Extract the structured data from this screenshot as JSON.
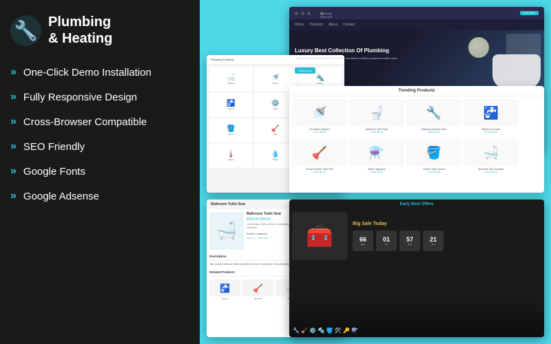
{
  "brand": {
    "name_line1": "Plumbing",
    "name_line2": "& Heating"
  },
  "features": [
    {
      "id": "one-click-demo",
      "label": "One-Click Demo Installation"
    },
    {
      "id": "fully-responsive",
      "label": "Fully Responsive Design"
    },
    {
      "id": "cross-browser",
      "label": "Cross-Browser Compatible"
    },
    {
      "id": "seo-friendly",
      "label": "SEO Friendly"
    },
    {
      "id": "google-fonts",
      "label": "Google Fonts"
    },
    {
      "id": "google-adsense",
      "label": "Google Adsense"
    }
  ],
  "preview": {
    "hero_title": "Luxury Best Collection Of Plumbing",
    "hero_desc": "Vestibulum ante ipsum primis in faucibus orci luctus et ultrices posuere cubilia curae",
    "hero_btn": "Shop Now",
    "trending_title": "Trending Products",
    "trending_products": [
      {
        "name": "Hot Water Systems",
        "price": "From $0.00",
        "icon": "🚿"
      },
      {
        "name": "Bathroom Toilet Seat",
        "price": "From $0.00",
        "icon": "🚽"
      },
      {
        "name": "Washing Machine Valve",
        "price": "From $0.00",
        "icon": "🔧"
      },
      {
        "name": "Bathroom Faucet",
        "price": "From $0.00",
        "icon": "🚰"
      }
    ],
    "detail_title": "Bathroom Toilet Seat",
    "detail_price": "$209.00 $99.00",
    "offers_title": "Early Best Offers",
    "offers_sale": "Big Sale Today",
    "timer": [
      {
        "value": "66",
        "label": ""
      },
      {
        "value": "01",
        "label": ""
      },
      {
        "value": "57",
        "label": ""
      },
      {
        "value": "21",
        "label": ""
      }
    ]
  },
  "colors": {
    "accent": "#2bbcd4",
    "dark_bg": "#1a1a1a",
    "light_bg": "#4dd8e8"
  }
}
